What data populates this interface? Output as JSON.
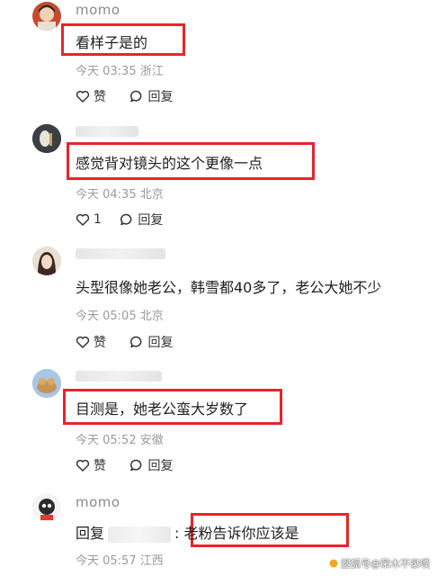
{
  "comments": [
    {
      "username": "momo",
      "text": "看样子是的",
      "time": "今天 03:35",
      "location": "浙江",
      "like_label": "赞",
      "reply_label": "回复"
    },
    {
      "username": "",
      "text": "感觉背对镜头的这个更像一点",
      "time": "今天 04:35",
      "location": "北京",
      "like_label": "1",
      "reply_label": "回复"
    },
    {
      "username": "",
      "text": "头型很像她老公，韩雪都40多了，老公大她不少",
      "time": "今天 05:05",
      "location": "北京",
      "like_label": "赞",
      "reply_label": "回复"
    },
    {
      "username": "",
      "text": "目测是，她老公蛮大岁数了",
      "time": "今天 05:52",
      "location": "安徽",
      "like_label": "赞",
      "reply_label": "回复"
    },
    {
      "username": "momo",
      "reply_prefix": "回复",
      "text": ": 老粉告诉你应该是",
      "time": "今天 05:57",
      "location": "江西"
    }
  ],
  "watermark": "搜狐号@荣木不录噗",
  "colors": {
    "highlight_border": "#e8242a",
    "meta_text": "#9a9a9a"
  }
}
